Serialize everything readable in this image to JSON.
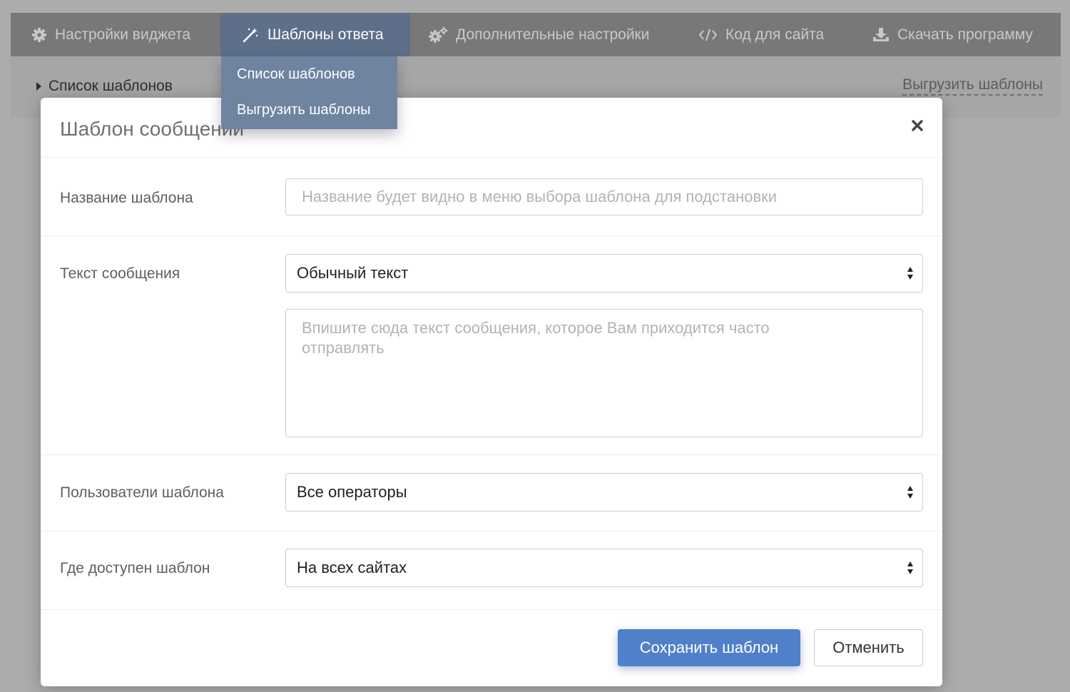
{
  "nav": {
    "items": [
      {
        "label": "Настройки виджета",
        "icon": "gear-icon"
      },
      {
        "label": "Шаблоны ответа",
        "icon": "magic-wand-icon",
        "active": true
      },
      {
        "label": "Дополнительные настройки",
        "icon": "gears-icon"
      },
      {
        "label": "Код для сайта",
        "icon": "code-icon"
      },
      {
        "label": "Скачать программу",
        "icon": "download-icon"
      }
    ]
  },
  "subbar": {
    "left_label": "Список шаблонов",
    "right_link": "Выгрузить шаблоны"
  },
  "dropdown": {
    "items": [
      "Список шаблонов",
      "Выгрузить шаблоны"
    ]
  },
  "modal": {
    "title": "Шаблон сообщений",
    "name_label": "Название шаблона",
    "name_placeholder": "Название будет видно в меню выбора шаблона для подстановки",
    "text_label": "Текст сообщения",
    "text_type_value": "Обычный текст",
    "text_placeholder": "Впишите сюда текст сообщения, которое Вам приходится часто отправлять",
    "users_label": "Пользователи шаблона",
    "users_value": "Все операторы",
    "where_label": "Где доступен шаблон",
    "where_value": "На всех сайтах",
    "save_button": "Сохранить шаблон",
    "cancel_button": "Отменить"
  },
  "colors": {
    "accent_primary": "#5180cb",
    "nav_active": "#5d6f89",
    "dropdown_bg": "#6e84a1"
  }
}
